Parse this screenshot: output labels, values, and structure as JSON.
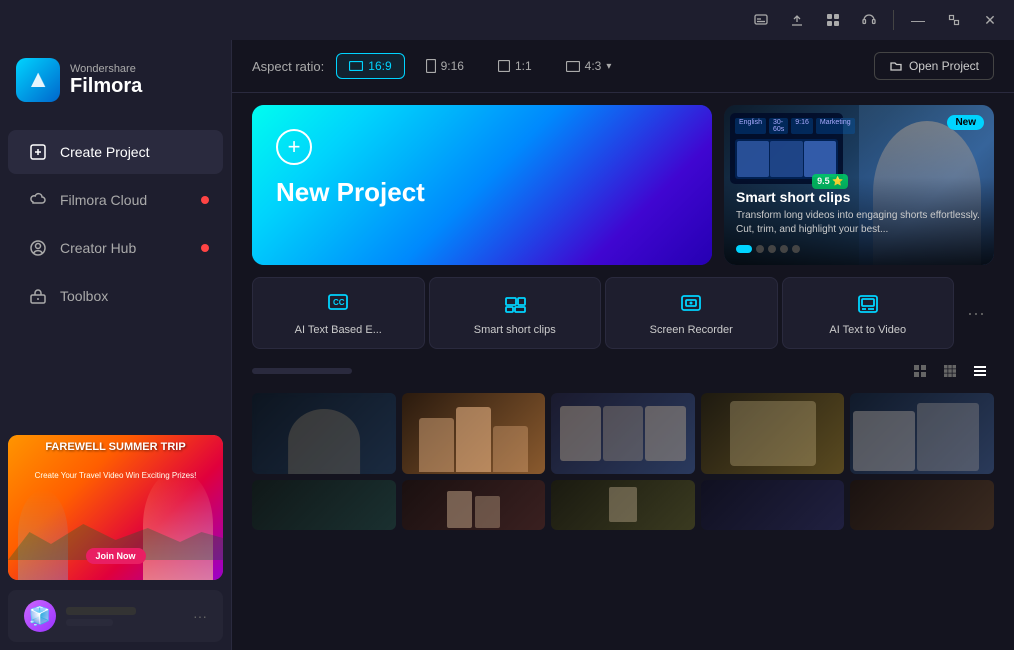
{
  "titlebar": {
    "controls": [
      "subtitle-icon",
      "upload-icon",
      "grid-icon",
      "headset-icon",
      "minimize-icon",
      "maximize-icon",
      "close-icon"
    ]
  },
  "sidebar": {
    "logo": {
      "brand": "Wondershare",
      "name": "Filmora"
    },
    "nav_items": [
      {
        "id": "create-project",
        "label": "Create Project",
        "active": true,
        "badge": false
      },
      {
        "id": "filmora-cloud",
        "label": "Filmora Cloud",
        "active": false,
        "badge": true
      },
      {
        "id": "creator-hub",
        "label": "Creator Hub",
        "active": false,
        "badge": true
      },
      {
        "id": "toolbox",
        "label": "Toolbox",
        "active": false,
        "badge": false
      }
    ],
    "ad": {
      "title": "FAREWELL SUMMER TRIP",
      "subtitle": "Create Your Travel Video Win Exciting Prizes!",
      "button": "Join Now"
    },
    "user": {
      "avatar": "🧊",
      "label": "···"
    }
  },
  "toolbar": {
    "aspect_ratio_label": "Aspect ratio:",
    "aspect_options": [
      {
        "id": "16-9",
        "label": "16:9",
        "active": true
      },
      {
        "id": "9-16",
        "label": "9:16",
        "active": false
      },
      {
        "id": "1-1",
        "label": "1:1",
        "active": false
      },
      {
        "id": "4-3",
        "label": "4:3",
        "active": false
      }
    ],
    "open_project_label": "Open Project"
  },
  "hero": {
    "new_project": {
      "icon": "+",
      "title": "New Project"
    },
    "featured": {
      "badge": "New",
      "title": "Smart short clips",
      "description": "Transform long videos into engaging shorts effortlessly. Cut, trim, and highlight your best...",
      "dots": 5,
      "active_dot": 0
    }
  },
  "quick_actions": [
    {
      "id": "ai-text-based",
      "label": "AI Text Based E...",
      "icon": "CC"
    },
    {
      "id": "smart-short-clips",
      "label": "Smart short clips",
      "icon": "✂"
    },
    {
      "id": "screen-recorder",
      "label": "Screen Recorder",
      "icon": "⊡"
    },
    {
      "id": "ai-text-to-video",
      "label": "AI Text to Video",
      "icon": "▣"
    }
  ],
  "recent": {
    "title": "···",
    "view_modes": [
      "grid-large",
      "grid-medium",
      "list"
    ]
  },
  "thumbnails_row1": [
    {
      "id": 1,
      "color_class": "thumb-1"
    },
    {
      "id": 2,
      "color_class": "thumb-2"
    },
    {
      "id": 3,
      "color_class": "thumb-3"
    },
    {
      "id": 4,
      "color_class": "thumb-4"
    },
    {
      "id": 5,
      "color_class": "thumb-5"
    }
  ],
  "thumbnails_row2": [
    {
      "id": 6,
      "color_class": "thumb-6"
    },
    {
      "id": 7,
      "color_class": "thumb-7"
    },
    {
      "id": 8,
      "color_class": "thumb-8"
    },
    {
      "id": 9,
      "color_class": "thumb-1"
    },
    {
      "id": 10,
      "color_class": "thumb-2"
    }
  ]
}
